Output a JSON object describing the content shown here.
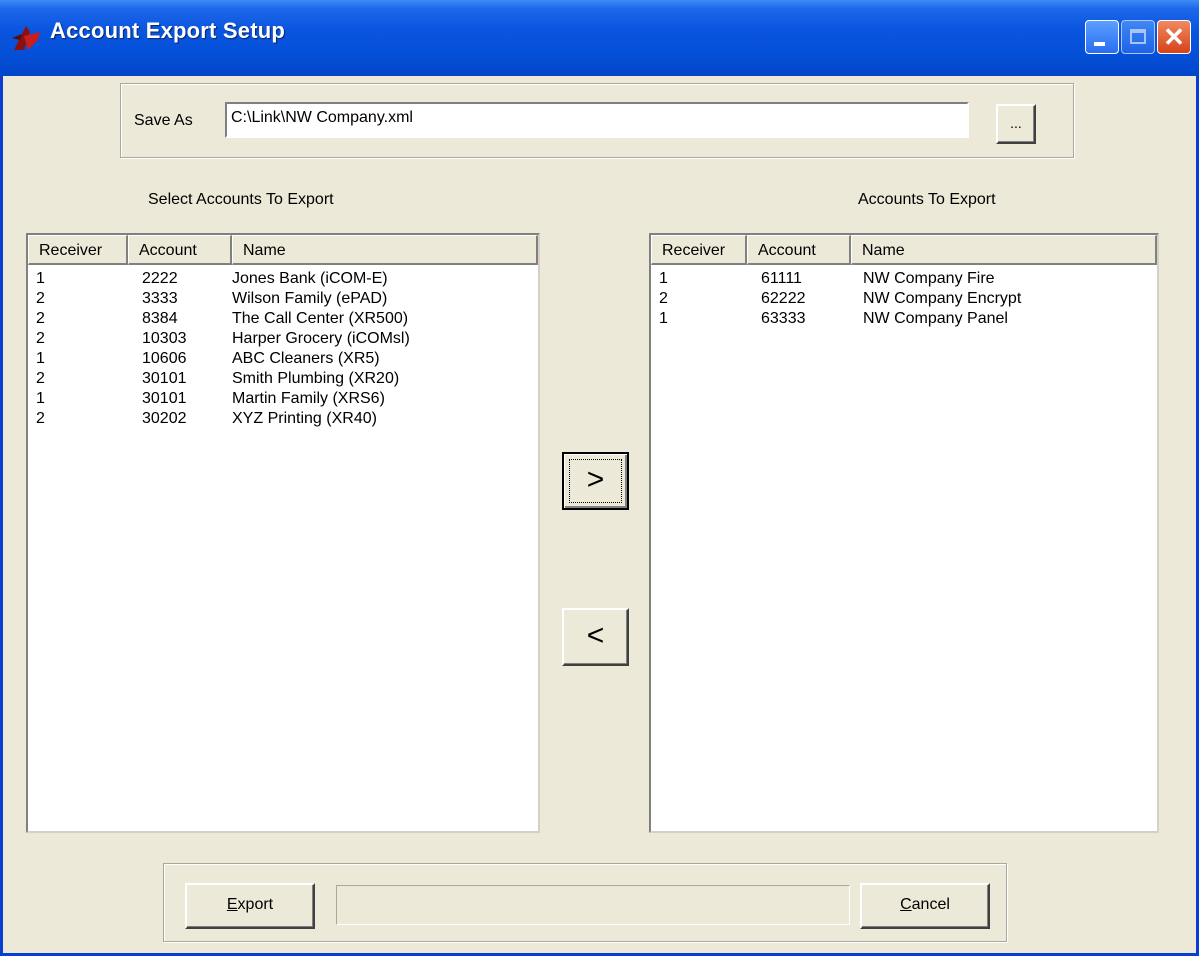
{
  "window": {
    "title": "Account Export Setup"
  },
  "save_as": {
    "label": "Save As",
    "value": "C:\\Link\\NW Company.xml",
    "browse_label": "..."
  },
  "left_panel": {
    "caption": "Select Accounts To Export",
    "columns": [
      "Receiver",
      "Account",
      "Name"
    ],
    "rows": [
      {
        "receiver": "1",
        "account": "2222",
        "name": "Jones Bank (iCOM-E)"
      },
      {
        "receiver": "2",
        "account": "3333",
        "name": "Wilson Family (ePAD)"
      },
      {
        "receiver": "2",
        "account": "8384",
        "name": "The Call Center (XR500)"
      },
      {
        "receiver": "2",
        "account": "10303",
        "name": "Harper Grocery (iCOMsl)"
      },
      {
        "receiver": "1",
        "account": "10606",
        "name": "ABC Cleaners (XR5)"
      },
      {
        "receiver": "2",
        "account": "30101",
        "name": "Smith Plumbing (XR20)"
      },
      {
        "receiver": "1",
        "account": "30101",
        "name": "Martin Family (XRS6)"
      },
      {
        "receiver": "2",
        "account": "30202",
        "name": "XYZ Printing (XR40)"
      }
    ]
  },
  "right_panel": {
    "caption": "Accounts To Export",
    "columns": [
      "Receiver",
      "Account",
      "Name"
    ],
    "rows": [
      {
        "receiver": "1",
        "account": "61111",
        "name": "NW Company Fire"
      },
      {
        "receiver": "2",
        "account": "62222",
        "name": "NW Company Encrypt"
      },
      {
        "receiver": "1",
        "account": "63333",
        "name": "NW Company Panel"
      }
    ]
  },
  "move_buttons": {
    "add_label": ">",
    "remove_label": "<"
  },
  "footer": {
    "export_mnemonic": "E",
    "export_rest": "xport",
    "status_text": "",
    "cancel_mnemonic": "C",
    "cancel_rest": "ancel"
  }
}
